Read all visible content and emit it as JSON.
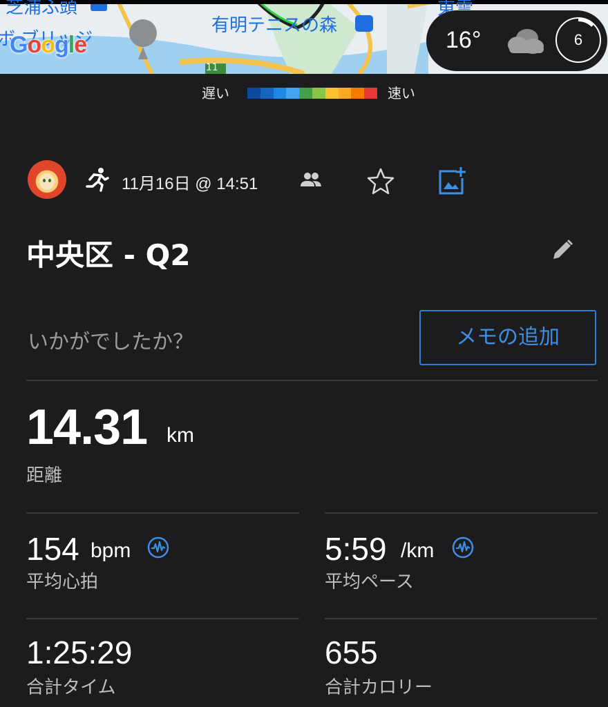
{
  "map": {
    "labels": {
      "top_left": "芝浦ふ頭",
      "bridge": "ボ ブリッジ",
      "park": "有明テニスの森",
      "road_number": "11",
      "top_right": "東雲"
    },
    "google_logo": "Google",
    "weather": {
      "temperature": "16°",
      "uv_index": "6"
    }
  },
  "legend": {
    "slow": "遅い",
    "fast": "速い",
    "colors": [
      "#0d47a1",
      "#1565c0",
      "#1e88e5",
      "#42a5f5",
      "#43a047",
      "#8bc34a",
      "#fbc02d",
      "#ffa726",
      "#f57c00",
      "#e53935"
    ]
  },
  "activity": {
    "datetime": "11月16日 @ 14:51",
    "title": "中央区 - Q2",
    "prompt": "いかがでしたか？",
    "memo_button": "メモの追加"
  },
  "stats": {
    "distance": {
      "value": "14.31",
      "unit": "km",
      "label": "距離"
    },
    "heart_rate": {
      "value": "154",
      "unit": "bpm",
      "label": "平均心拍"
    },
    "pace": {
      "value": "5:59",
      "unit": "/km",
      "label": "平均ペース"
    },
    "time": {
      "value": "1:25:29",
      "label": "合計タイム"
    },
    "calories": {
      "value": "655",
      "label": "合計カロリー"
    }
  },
  "colors": {
    "background": "#1c1c1e",
    "accent_blue": "#3e8fe3",
    "divider": "#3a3a3c"
  }
}
